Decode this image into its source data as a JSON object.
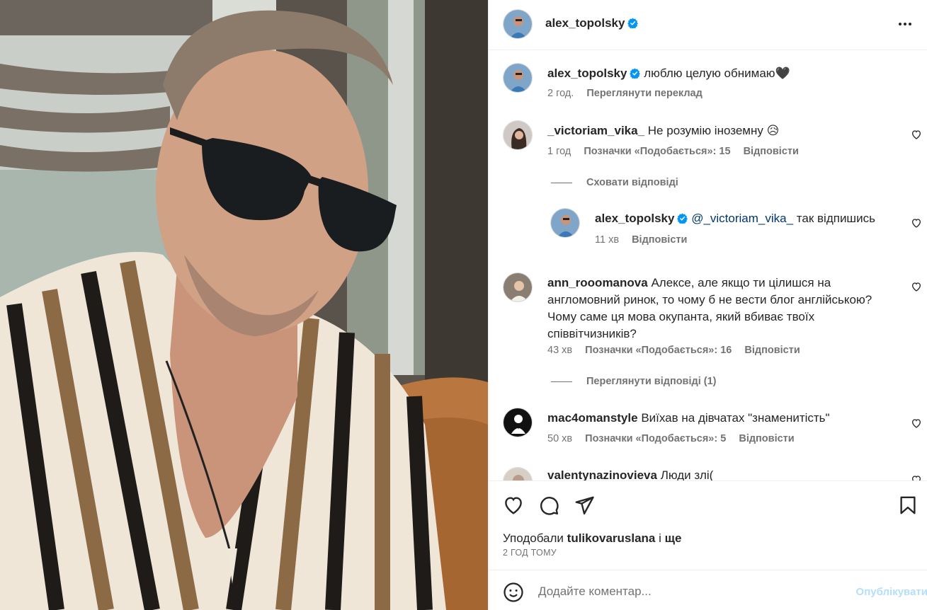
{
  "post": {
    "author": "alex_topolsky",
    "more_icon": "more-horizontal-icon"
  },
  "caption": {
    "username": "alex_topolsky",
    "text": "люблю целую обнимаю🖤",
    "time": "2 год.",
    "translate": "Переглянути переклад"
  },
  "comments": [
    {
      "username": "_victoriam_vika_",
      "text": "Не розумію іноземну 😥",
      "time": "1 год",
      "likes": "Позначки «Подобається»: 15",
      "reply": "Відповісти"
    },
    {
      "username": "ann_rooomanova",
      "text": "Алексе, але якщо ти цілишся на англомовний ринок, то чому б не вести блог англійською? Чому саме ця мова окупанта, який вбиває твоїх співвітчизників?",
      "time": "43 хв",
      "likes": "Позначки «Подобається»: 16",
      "reply": "Відповісти"
    },
    {
      "username": "mac4omanstyle",
      "text": "Виїхав на дівчатах \"знаменитість\"",
      "time": "50 хв",
      "likes": "Позначки «Подобається»: 5",
      "reply": "Відповісти"
    },
    {
      "username": "valentynazinovieva",
      "text": "Люди злі("
    }
  ],
  "hide_replies": "Сховати відповіді",
  "view_replies": "Переглянути відповіді (1)",
  "reply": {
    "username": "alex_topolsky",
    "mention": "@_victoriam_vika_",
    "text": "так відпишись",
    "time": "11 хв",
    "reply": "Відповісти"
  },
  "actions": {
    "like_icon": "heart-icon",
    "comment_icon": "comment-icon",
    "share_icon": "send-icon",
    "save_icon": "bookmark-icon",
    "liked_by_prefix": "Уподобали",
    "liked_by_user": "tulikovaruslana",
    "liked_by_and": "і",
    "liked_by_more": "ще",
    "post_time": "2 ГОД ТОМУ"
  },
  "comment_box": {
    "placeholder": "Додайте коментар...",
    "publish": "Опублікувати",
    "emoji_icon": "emoji-icon"
  },
  "colors": {
    "verified": "#0095f6",
    "secondary_text": "#737373",
    "publish_disabled": "#b2dffc",
    "mention": "#00376b"
  }
}
